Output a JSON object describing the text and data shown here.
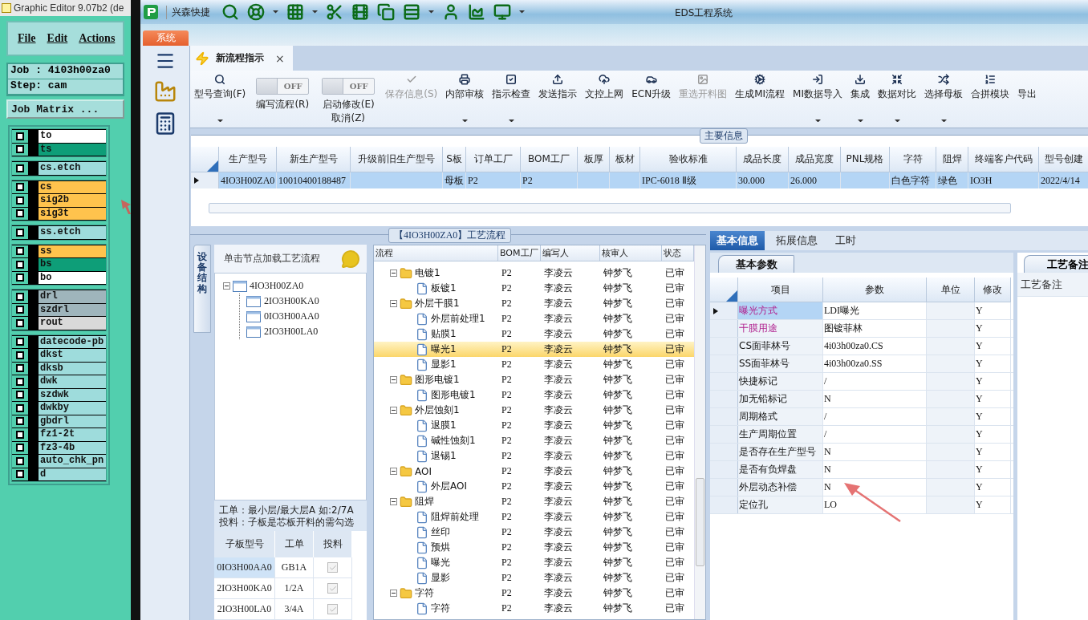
{
  "editor": {
    "title": "Graphic Editor 9.07b2 (de",
    "menu": [
      "File",
      "Edit",
      "Actions"
    ],
    "job": "Job : 4i03h00za0",
    "step": "Step: cam",
    "matrix_button": "Job Matrix ...",
    "layer_groups": [
      {
        "layers": [
          {
            "name": "to",
            "color": "#ffffff",
            "checked": false
          },
          {
            "name": "ts",
            "color": "#0e9e78",
            "checked": false
          }
        ]
      },
      {
        "layers": [
          {
            "name": "cs.etch",
            "color": "#9edcdc",
            "checked": false
          }
        ]
      },
      {
        "layers": [
          {
            "name": "cs",
            "color": "#ffc34d",
            "checked": false
          },
          {
            "name": "sig2b",
            "color": "#ffc34d",
            "checked": false
          },
          {
            "name": "sig3t",
            "color": "#ffc34d",
            "checked": false
          }
        ]
      },
      {
        "layers": [
          {
            "name": "ss.etch",
            "color": "#9edcdc",
            "checked": false
          }
        ]
      },
      {
        "layers": [
          {
            "name": "ss",
            "color": "#ffc34d",
            "checked": false
          },
          {
            "name": "bs",
            "color": "#0e9e78",
            "checked": false
          },
          {
            "name": "bo",
            "color": "#ffffff",
            "checked": false
          }
        ]
      },
      {
        "layers": [
          {
            "name": "drl",
            "color": "#9fb5bc",
            "checked": false
          },
          {
            "name": "szdrl",
            "color": "#9fb5bc",
            "checked": false
          },
          {
            "name": "rout",
            "color": "#d9d9d9",
            "checked": false
          }
        ]
      },
      {
        "layers": [
          {
            "name": "datecode-pb",
            "color": "#9edcdc",
            "checked": false
          },
          {
            "name": "dkst",
            "color": "#9edcdc",
            "checked": false
          },
          {
            "name": "dksb",
            "color": "#9edcdc",
            "checked": false
          },
          {
            "name": "dwk",
            "color": "#9edcdc",
            "checked": false
          },
          {
            "name": "szdwk",
            "color": "#9edcdc",
            "checked": false
          },
          {
            "name": "dwkby",
            "color": "#9edcdc",
            "checked": false
          },
          {
            "name": "gbdrl",
            "color": "#9edcdc",
            "checked": false
          },
          {
            "name": "fz1-2t",
            "color": "#9edcdc",
            "checked": false
          },
          {
            "name": "fz3-4b",
            "color": "#9edcdc",
            "checked": false
          },
          {
            "name": "auto_chk_pn",
            "color": "#9edcdc",
            "checked": false
          },
          {
            "name": "d",
            "color": "#9edcdc",
            "checked": false
          }
        ]
      }
    ]
  },
  "eds": {
    "title": "EDS工程系统",
    "app_name": "兴森快捷",
    "system_tab": "系统",
    "doc_tab": {
      "label": "新流程指示",
      "close": "×"
    },
    "ribbon": [
      {
        "kind": "button",
        "label": "型号查询(F)",
        "dropdown": true,
        "disabled": false
      },
      {
        "kind": "toggle",
        "label": "编写流程(R)",
        "state_text": "OFF",
        "on": false
      },
      {
        "kind": "toggle",
        "label": "启动修改(E)\n取消(Z)",
        "state_text": "OFF",
        "on": false
      },
      {
        "kind": "button",
        "label": "保存信息(S)",
        "dropdown": false,
        "disabled": true
      },
      {
        "kind": "button",
        "label": "内部审核",
        "dropdown": true,
        "disabled": false
      },
      {
        "kind": "button",
        "label": "指示检查",
        "dropdown": true,
        "disabled": false
      },
      {
        "kind": "button",
        "label": "发送指示",
        "dropdown": false,
        "disabled": false
      },
      {
        "kind": "button",
        "label": "文控上网",
        "dropdown": false,
        "disabled": false
      },
      {
        "kind": "button",
        "label": "ECN升级",
        "dropdown": false,
        "disabled": false
      },
      {
        "kind": "button",
        "label": "重选开料图",
        "dropdown": false,
        "disabled": true
      },
      {
        "kind": "button",
        "label": "生成MI流程",
        "dropdown": false,
        "disabled": false
      },
      {
        "kind": "button",
        "label": "MI数据导入",
        "dropdown": true,
        "disabled": false
      },
      {
        "kind": "button",
        "label": "集成",
        "dropdown": true,
        "disabled": false
      },
      {
        "kind": "button",
        "label": "数据对比",
        "dropdown": true,
        "disabled": false
      },
      {
        "kind": "button",
        "label": "选择母板",
        "dropdown": true,
        "disabled": false
      },
      {
        "kind": "button",
        "label": "合拼模块",
        "dropdown": false,
        "disabled": false
      },
      {
        "kind": "button",
        "label": "导出",
        "dropdown": false,
        "disabled": false
      }
    ],
    "main_info": {
      "title": "主要信息",
      "columns": [
        "生产型号",
        "新生产型号",
        "升级前旧生产型号",
        "S板",
        "订单工厂",
        "BOM工厂",
        "板厚",
        "板材",
        "验收标准",
        "成品长度",
        "成品宽度",
        "PNL规格",
        "字符",
        "阻焊",
        "终端客户代码",
        "型号创建"
      ],
      "rows": [
        {
          "selected": true,
          "cells": [
            "4IO3H00ZA0",
            "10010400188487",
            null,
            "母板",
            "P2",
            "P2",
            null,
            null,
            "IPC-6018 Ⅱ级",
            "30.000",
            "26.000",
            null,
            "白色字符",
            "绿色",
            "IO3H",
            "2022/4/14"
          ]
        }
      ]
    },
    "flow": {
      "title": "【4IO3H00ZA0】工艺流程",
      "side_tab": "设备结构",
      "tree_hint": "单击节点加载工艺流程",
      "tree": [
        {
          "label": "4IO3H00ZA0",
          "expanded": true,
          "children": [
            {
              "label": "2IO3H00KA0"
            },
            {
              "label": "0IO3H00AA0"
            },
            {
              "label": "2IO3H00LA0"
            }
          ]
        }
      ],
      "notes": [
        "工单：最小层/最大层A 如:2/7A",
        "投料：子板是芯板开料的需勾选"
      ],
      "boards": {
        "columns": [
          "子板型号",
          "工单",
          "投料"
        ],
        "rows": [
          {
            "model": "0IO3H00AA0",
            "order": "GB1A",
            "checked": true,
            "selected": true
          },
          {
            "model": "2IO3H00KA0",
            "order": "1/2A",
            "checked": true,
            "selected": false
          },
          {
            "model": "2IO3H00LA0",
            "order": "3/4A",
            "checked": true,
            "selected": false
          }
        ]
      },
      "grid": {
        "columns": [
          "流程",
          "BOM工厂",
          "编写人",
          "核审人",
          "状态"
        ],
        "rows": [
          {
            "name": "电镀1",
            "bom": "P2",
            "writer": "李凌云",
            "reviewer": "钟梦飞",
            "status": "已审",
            "expanded": true,
            "selected": false,
            "children": [
              {
                "name": "板镀1",
                "bom": "P2",
                "writer": "李凌云",
                "reviewer": "钟梦飞",
                "status": "已审",
                "selected": false
              }
            ]
          },
          {
            "name": "外层干膜1",
            "bom": "P2",
            "writer": "李凌云",
            "reviewer": "钟梦飞",
            "status": "已审",
            "expanded": true,
            "selected": false,
            "children": [
              {
                "name": "外层前处理1",
                "bom": "P2",
                "writer": "李凌云",
                "reviewer": "钟梦飞",
                "status": "已审",
                "selected": false
              },
              {
                "name": "贴膜1",
                "bom": "P2",
                "writer": "李凌云",
                "reviewer": "钟梦飞",
                "status": "已审",
                "selected": false
              },
              {
                "name": "曝光1",
                "bom": "P2",
                "writer": "李凌云",
                "reviewer": "钟梦飞",
                "status": "已审",
                "selected": true
              },
              {
                "name": "显影1",
                "bom": "P2",
                "writer": "李凌云",
                "reviewer": "钟梦飞",
                "status": "已审",
                "selected": false
              }
            ]
          },
          {
            "name": "图形电镀1",
            "bom": "P2",
            "writer": "李凌云",
            "reviewer": "钟梦飞",
            "status": "已审",
            "expanded": true,
            "selected": false,
            "children": [
              {
                "name": "图形电镀1",
                "bom": "P2",
                "writer": "李凌云",
                "reviewer": "钟梦飞",
                "status": "已审",
                "selected": false
              }
            ]
          },
          {
            "name": "外层蚀刻1",
            "bom": "P2",
            "writer": "李凌云",
            "reviewer": "钟梦飞",
            "status": "已审",
            "expanded": true,
            "selected": false,
            "children": [
              {
                "name": "退膜1",
                "bom": "P2",
                "writer": "李凌云",
                "reviewer": "钟梦飞",
                "status": "已审",
                "selected": false
              },
              {
                "name": "碱性蚀刻1",
                "bom": "P2",
                "writer": "李凌云",
                "reviewer": "钟梦飞",
                "status": "已审",
                "selected": false
              },
              {
                "name": "退锡1",
                "bom": "P2",
                "writer": "李凌云",
                "reviewer": "钟梦飞",
                "status": "已审",
                "selected": false
              }
            ]
          },
          {
            "name": "AOI",
            "bom": "P2",
            "writer": "李凌云",
            "reviewer": "钟梦飞",
            "status": "已审",
            "expanded": true,
            "selected": false,
            "children": [
              {
                "name": "外层AOI",
                "bom": "P2",
                "writer": "李凌云",
                "reviewer": "钟梦飞",
                "status": "已审",
                "selected": false
              }
            ]
          },
          {
            "name": "阻焊",
            "bom": "P2",
            "writer": "李凌云",
            "reviewer": "钟梦飞",
            "status": "已审",
            "expanded": true,
            "selected": false,
            "children": [
              {
                "name": "阻焊前处理",
                "bom": "P2",
                "writer": "李凌云",
                "reviewer": "钟梦飞",
                "status": "已审",
                "selected": false
              },
              {
                "name": "丝印",
                "bom": "P2",
                "writer": "李凌云",
                "reviewer": "钟梦飞",
                "status": "已审",
                "selected": false
              },
              {
                "name": "预烘",
                "bom": "P2",
                "writer": "李凌云",
                "reviewer": "钟梦飞",
                "status": "已审",
                "selected": false
              },
              {
                "name": "曝光",
                "bom": "P2",
                "writer": "李凌云",
                "reviewer": "钟梦飞",
                "status": "已审",
                "selected": false
              },
              {
                "name": "显影",
                "bom": "P2",
                "writer": "李凌云",
                "reviewer": "钟梦飞",
                "status": "已审",
                "selected": false
              }
            ]
          },
          {
            "name": "字符",
            "bom": "P2",
            "writer": "李凌云",
            "reviewer": "钟梦飞",
            "status": "已审",
            "expanded": true,
            "selected": false,
            "children": [
              {
                "name": "字符",
                "bom": "P2",
                "writer": "李凌云",
                "reviewer": "钟梦飞",
                "status": "已审",
                "selected": false
              }
            ]
          }
        ]
      }
    }
  },
  "details": {
    "tabs": [
      {
        "label": "基本信息",
        "selected": true
      },
      {
        "label": "拓展信息",
        "selected": false
      },
      {
        "label": "工时",
        "selected": false
      }
    ],
    "sub_tab": "基本参数",
    "params": {
      "columns": [
        "项目",
        "参数",
        "单位",
        "修改"
      ],
      "rows": [
        {
          "item": "曝光方式",
          "value": "LDI曝光",
          "modify": "Y",
          "emphasized": true,
          "selected": true
        },
        {
          "item": "干膜用途",
          "value": "图镀菲林",
          "modify": "Y",
          "emphasized": true,
          "selected": false
        },
        {
          "item": "CS面菲林号",
          "value": "4i03h00za0.CS",
          "modify": "Y",
          "emphasized": false,
          "selected": false
        },
        {
          "item": "SS面菲林号",
          "value": "4i03h00za0.SS",
          "modify": "Y",
          "emphasized": false,
          "selected": false
        },
        {
          "item": "快捷标记",
          "value": "/",
          "modify": "Y",
          "emphasized": false,
          "selected": false
        },
        {
          "item": "加无铅标记",
          "value": "N",
          "modify": "Y",
          "emphasized": false,
          "selected": false
        },
        {
          "item": "周期格式",
          "value": "/",
          "modify": "Y",
          "emphasized": false,
          "selected": false
        },
        {
          "item": "生产周期位置",
          "value": "/",
          "modify": "Y",
          "emphasized": false,
          "selected": false
        },
        {
          "item": "是否存在生产型号",
          "value": "N",
          "modify": "Y",
          "emphasized": false,
          "selected": false
        },
        {
          "item": "是否有负焊盘",
          "value": "N",
          "modify": "Y",
          "emphasized": false,
          "selected": false
        },
        {
          "item": "外层动态补偿",
          "value": "N",
          "modify": "Y",
          "emphasized": false,
          "selected": false
        },
        {
          "item": "定位孔",
          "value": "LO",
          "modify": "Y",
          "emphasized": false,
          "selected": false
        }
      ]
    },
    "notes_panel": {
      "tab": "工艺备注",
      "label": "工艺备注"
    }
  }
}
